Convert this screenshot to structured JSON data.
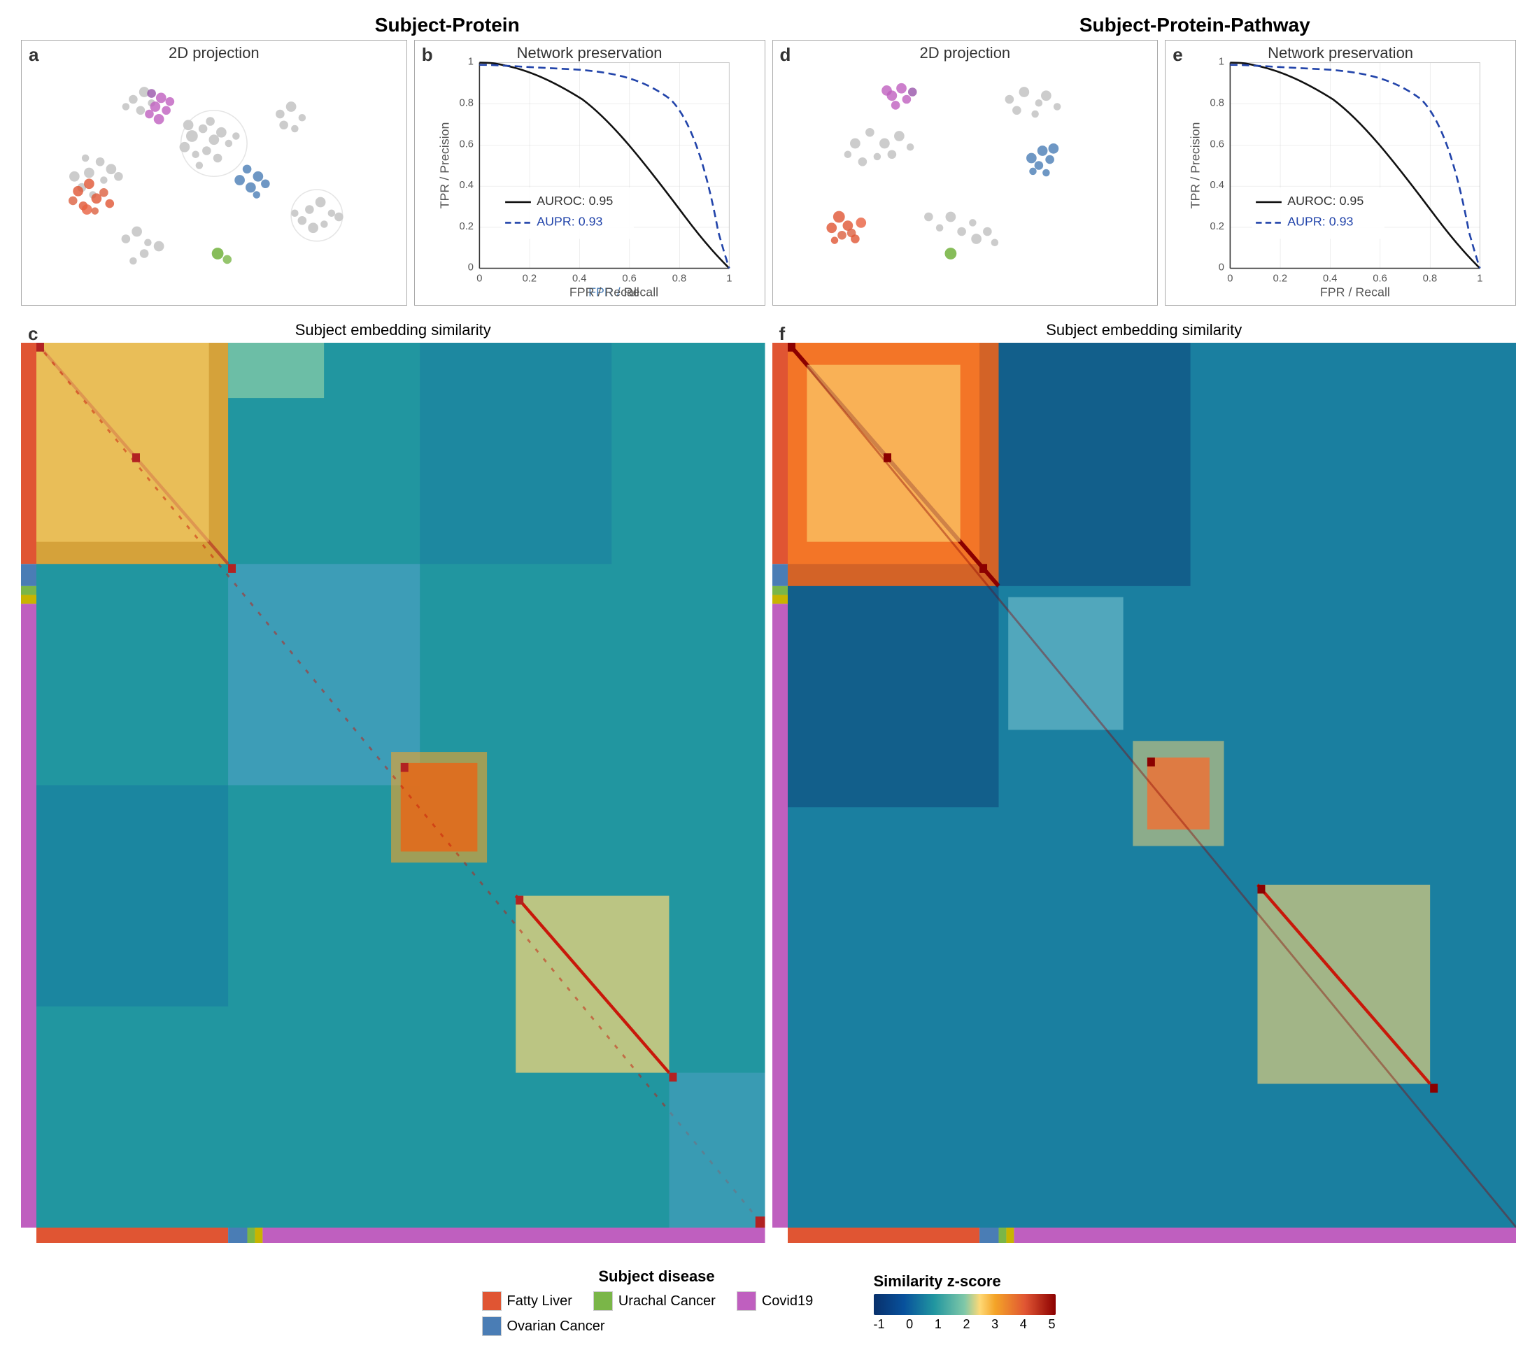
{
  "sections": {
    "left_title": "Subject-Protein",
    "right_title": "Subject-Protein-Pathway"
  },
  "panels": {
    "a": {
      "label": "a",
      "title": "2D projection"
    },
    "b": {
      "label": "b",
      "title": "Network preservation",
      "x_axis": "FPR / Recall",
      "y_axis": "TPR / Precision",
      "auroc_label": "AUROC: 0.95",
      "aupr_label": "AUPR: 0.93"
    },
    "c": {
      "label": "c",
      "title": "Subject embedding similarity"
    },
    "d": {
      "label": "d",
      "title": "2D projection"
    },
    "e": {
      "label": "e",
      "title": "Network preservation",
      "x_axis": "FPR / Recall",
      "y_axis": "TPR / Precision",
      "auroc_label": "AUROC: 0.95",
      "aupr_label": "AUPR: 0.93"
    },
    "f": {
      "label": "f",
      "title": "Subject embedding similarity"
    }
  },
  "legend": {
    "disease_title": "Subject disease",
    "items": [
      {
        "label": "Fatty Liver",
        "color": "#E05533"
      },
      {
        "label": "Covid19",
        "color": "#BF5FBF"
      },
      {
        "label": "Urachal Cancer",
        "color": "#7AB648"
      },
      {
        "label": "Ovarian Cancer",
        "color": "#4A7DB5"
      }
    ],
    "colorbar_title": "Similarity z-score",
    "colorbar_ticks": [
      "-1",
      "0",
      "1",
      "2",
      "3",
      "4",
      "5"
    ]
  }
}
